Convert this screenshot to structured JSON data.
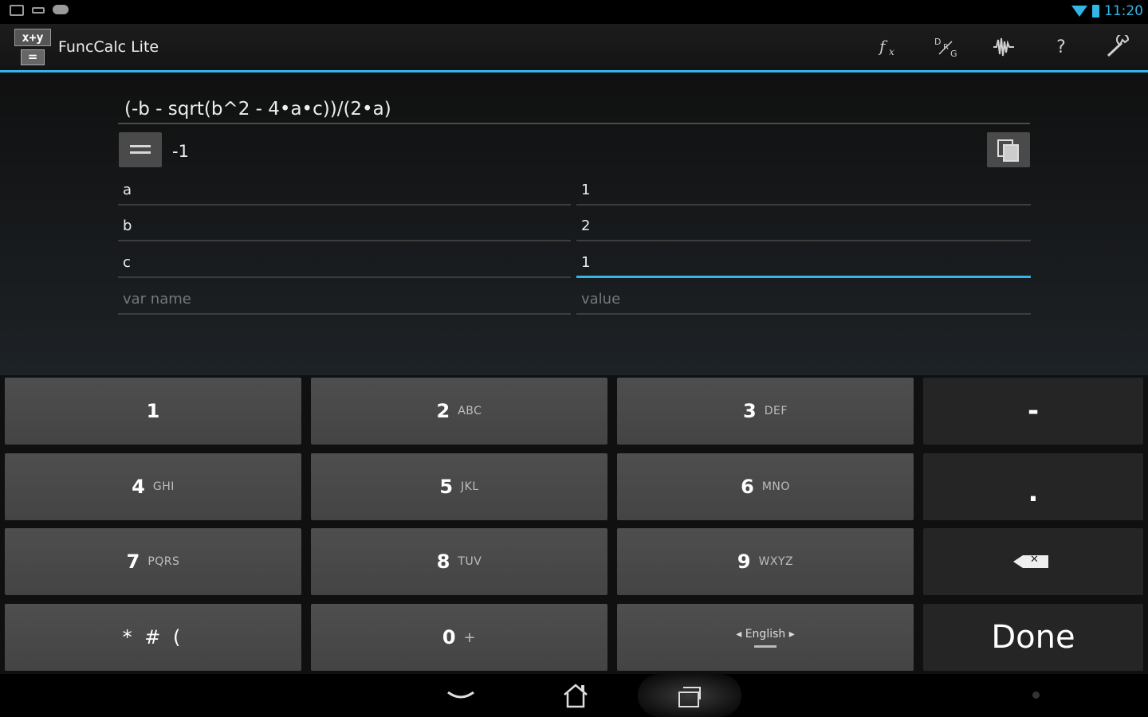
{
  "status_bar": {
    "time": "11:20"
  },
  "app": {
    "title": "FuncCalc Lite",
    "icon_top": "x+y",
    "icon_bottom": "=",
    "actions": [
      "function-icon",
      "degrees-icon",
      "waveform-icon",
      "help-icon",
      "settings-wrench-icon"
    ],
    "help_label": "?"
  },
  "calculator": {
    "expression": "(-b - sqrt(b^2 - 4•a•c))/(2•a)",
    "result": "-1",
    "variables": [
      {
        "name": "a",
        "value": "1"
      },
      {
        "name": "b",
        "value": "2"
      },
      {
        "name": "c",
        "value": "1"
      }
    ],
    "new_var_placeholder": "var name",
    "new_value_placeholder": "value"
  },
  "keyboard": {
    "keys": {
      "k1": {
        "main": "1",
        "sub": ""
      },
      "k2": {
        "main": "2",
        "sub": "ABC"
      },
      "k3": {
        "main": "3",
        "sub": "DEF"
      },
      "k4": {
        "main": "4",
        "sub": "GHI"
      },
      "k5": {
        "main": "5",
        "sub": "JKL"
      },
      "k6": {
        "main": "6",
        "sub": "MNO"
      },
      "k7": {
        "main": "7",
        "sub": "PQRS"
      },
      "k8": {
        "main": "8",
        "sub": "TUV"
      },
      "k9": {
        "main": "9",
        "sub": "WXYZ"
      },
      "k0": {
        "main": "0",
        "sub": "+"
      },
      "symbols": "* # (",
      "minus": "-",
      "dot": ".",
      "language": "◂ English ▸",
      "done": "Done"
    }
  },
  "colors": {
    "accent": "#33b5e5",
    "key": "#484848",
    "key_dark": "#252525"
  }
}
